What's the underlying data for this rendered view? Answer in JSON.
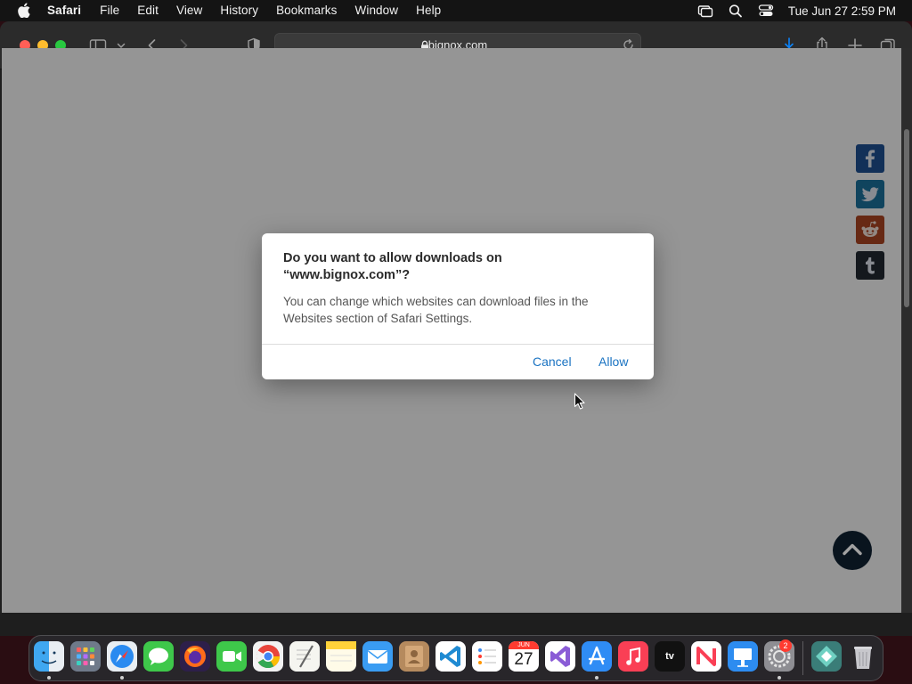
{
  "menubar": {
    "app_name": "Safari",
    "items": [
      "File",
      "Edit",
      "View",
      "History",
      "Bookmarks",
      "Window",
      "Help"
    ],
    "clock": "Tue Jun 27  2:59 PM"
  },
  "toolbar": {
    "url": "bignox.com"
  },
  "dialog": {
    "title": "Do you want to allow downloads on “www.bignox.com”?",
    "message": "You can change which websites can download files in the Websites section of Safari Settings.",
    "cancel_label": "Cancel",
    "allow_label": "Allow"
  },
  "dock": {
    "calendar_month": "JUN",
    "calendar_day": "27",
    "tv_label": "tv",
    "settings_badge": "2"
  }
}
